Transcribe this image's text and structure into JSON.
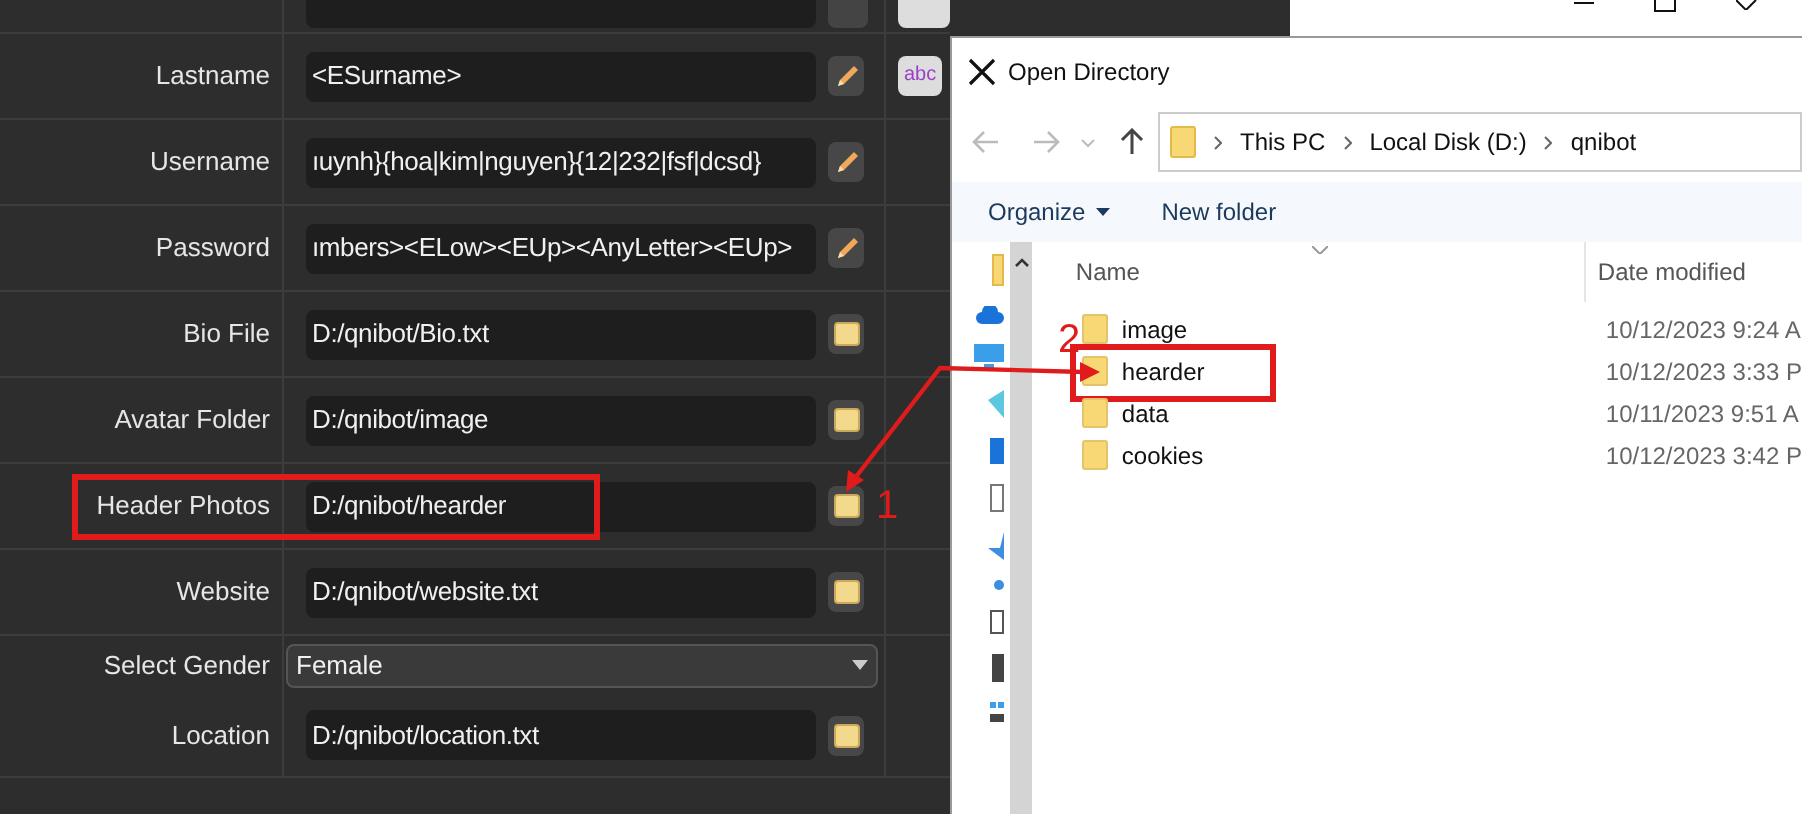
{
  "form": {
    "rows": [
      {
        "label": "Lastname",
        "value": "<ESurname>",
        "kind": "text",
        "button": {
          "kind": "edit"
        },
        "highlighted": false,
        "side_button": "abc"
      },
      {
        "label": "Username",
        "value": "ıuynh}{hoa|kim|nguyen}{12|232|fsf|dcsd}",
        "kind": "text",
        "button": {
          "kind": "edit"
        },
        "highlighted": false
      },
      {
        "label": "Password",
        "value": "ımbers><ELow><EUp><AnyLetter><EUp>",
        "kind": "text",
        "button": {
          "kind": "edit"
        },
        "highlighted": false
      },
      {
        "label": "Bio File",
        "value": "D:/qnibot/Bio.txt",
        "kind": "text",
        "button": {
          "kind": "browse"
        },
        "highlighted": false
      },
      {
        "label": "Avatar Folder",
        "value": "D:/qnibot/image",
        "kind": "text",
        "button": {
          "kind": "browse"
        },
        "highlighted": false
      },
      {
        "label": "Header Photos",
        "value": "D:/qnibot/hearder",
        "kind": "text",
        "button": {
          "kind": "browse"
        },
        "highlighted": true
      },
      {
        "label": "Website",
        "value": "D:/qnibot/website.txt",
        "kind": "text",
        "button": {
          "kind": "browse"
        },
        "highlighted": false
      },
      {
        "label": "Select Gender",
        "value": "Female",
        "kind": "select",
        "highlighted": false
      },
      {
        "label": "Location",
        "value": "D:/qnibot/location.txt",
        "kind": "text",
        "button": {
          "kind": "browse"
        },
        "highlighted": false
      }
    ]
  },
  "dialog": {
    "title": "Open Directory",
    "breadcrumb": [
      "This PC",
      "Local Disk (D:)",
      "qnibot"
    ],
    "toolbar": {
      "organize": "Organize",
      "new_folder": "New folder"
    },
    "columns": [
      "Name",
      "Date modified"
    ],
    "files": [
      {
        "name": "image",
        "date": "10/12/2023 9:24 A",
        "highlighted": false
      },
      {
        "name": "hearder",
        "date": "10/12/2023 3:33 P",
        "highlighted": true
      },
      {
        "name": "data",
        "date": "10/11/2023 9:51 A",
        "highlighted": false
      },
      {
        "name": "cookies",
        "date": "10/12/2023 3:42 P",
        "highlighted": false
      }
    ]
  },
  "annotations": [
    "1",
    "2"
  ]
}
